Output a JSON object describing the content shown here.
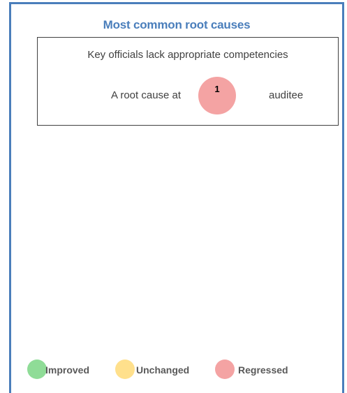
{
  "panel": {
    "title": "Most common root causes"
  },
  "root_cause": {
    "heading": "Key officials lack appropriate competencies",
    "prefix": "A root cause at",
    "count": "1",
    "suffix": "auditee",
    "status": "Regressed",
    "bubble_color": "#f4a3a3"
  },
  "legend": {
    "items": [
      {
        "label": "Improved",
        "color": "#8fdc97"
      },
      {
        "label": "Unchanged",
        "color": "#ffe08c"
      },
      {
        "label": "Regressed",
        "color": "#f4a3a3"
      }
    ]
  },
  "colors": {
    "frame": "#4a7ebb",
    "title": "#4a7ebb",
    "text": "#404040"
  }
}
